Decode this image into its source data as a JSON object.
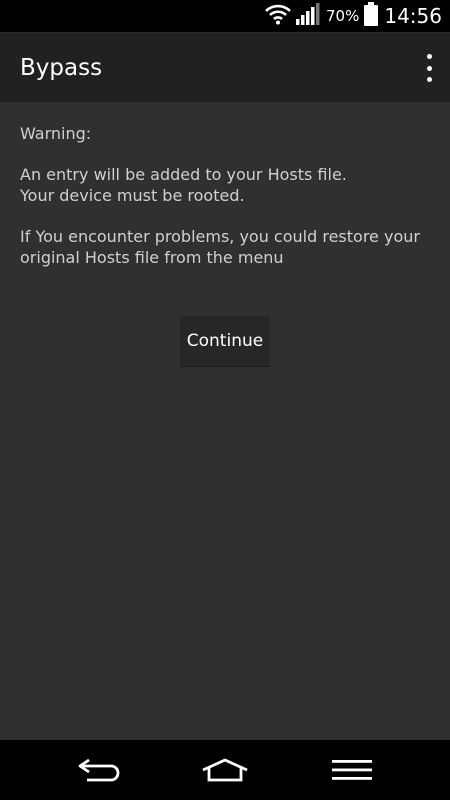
{
  "status_bar": {
    "battery_percent": "70%",
    "time": "14:56",
    "icons": [
      "wifi-icon",
      "signal-icon",
      "battery-icon"
    ]
  },
  "action_bar": {
    "title": "Bypass",
    "overflow_icon": "overflow-menu-icon"
  },
  "content": {
    "warning_label": "Warning:",
    "entry_text": "An entry will be added to your Hosts file.",
    "rooted_text": "Your device must be rooted.",
    "problems_text": "If You encounter problems, you could restore your original Hosts file from the menu",
    "continue_label": "Continue"
  },
  "nav_bar": {
    "icons": [
      "back-icon",
      "home-icon",
      "menu-icon"
    ]
  },
  "colors": {
    "status_bar": "#000000",
    "action_bar": "#212121",
    "background": "#303030",
    "button": "#252729",
    "text": "#d0d0d0"
  }
}
